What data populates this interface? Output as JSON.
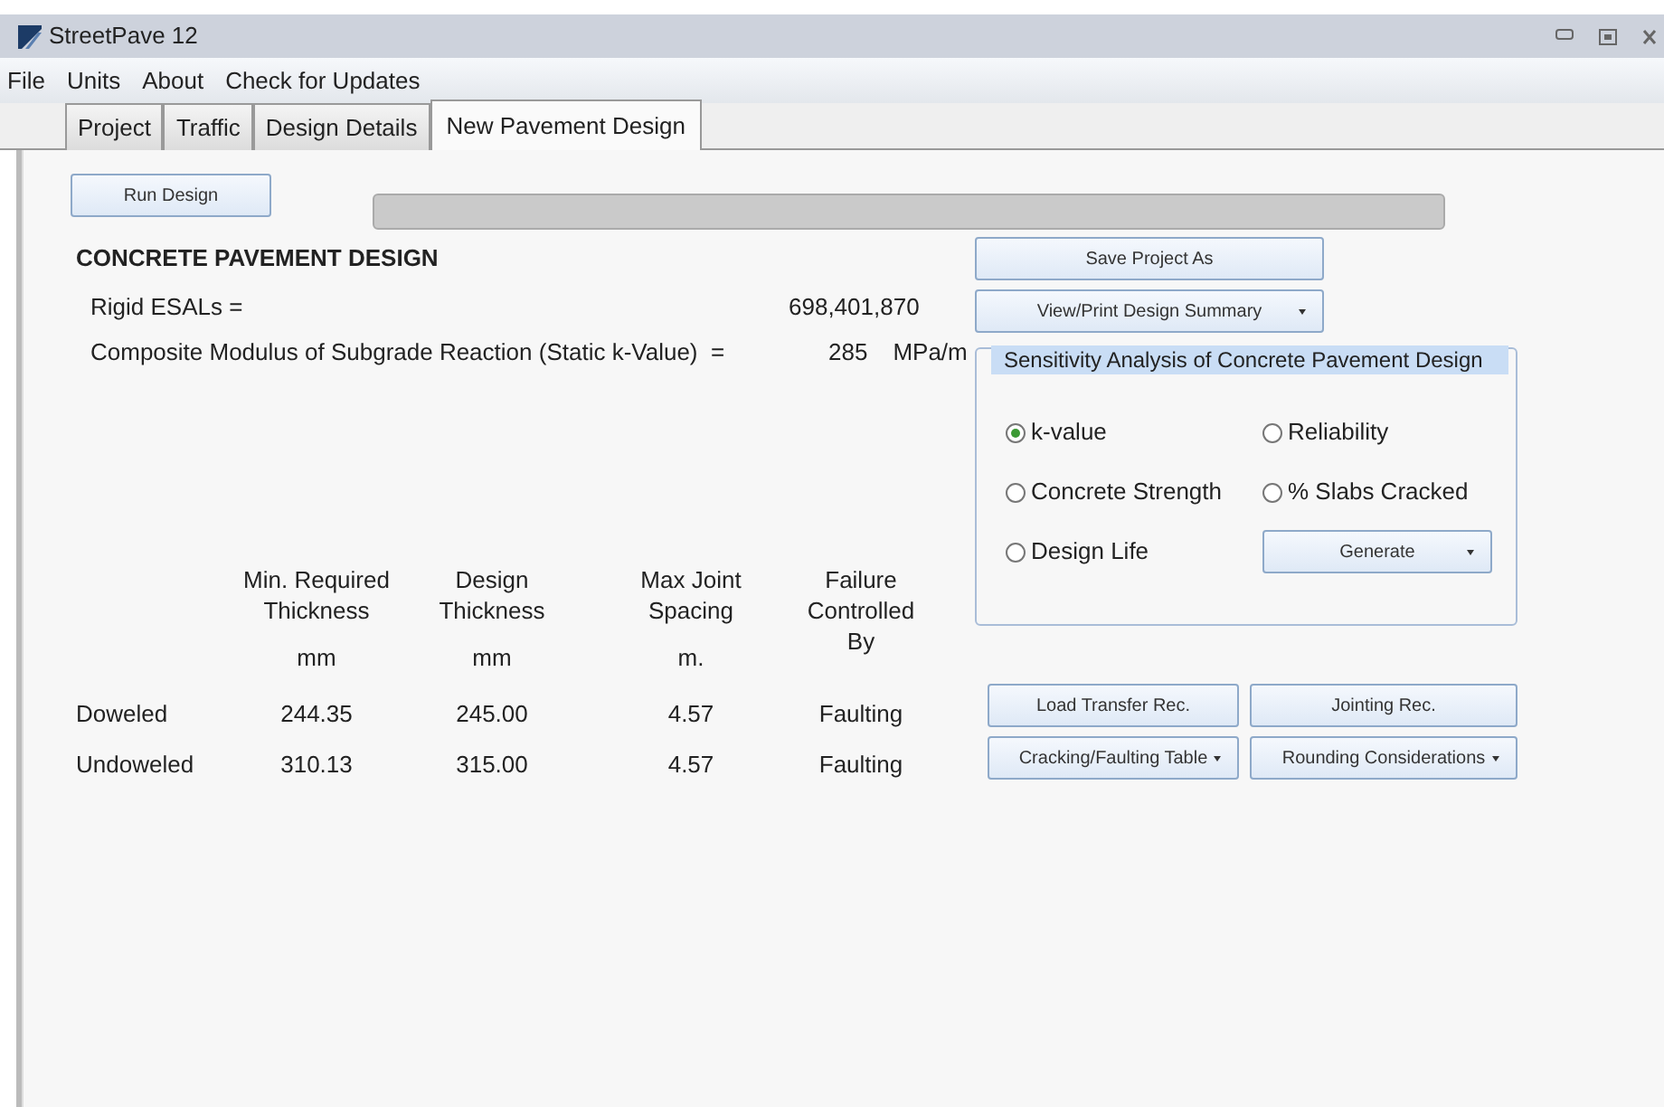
{
  "window": {
    "title": "StreetPave 12"
  },
  "menu": [
    "File",
    "Units",
    "About",
    "Check for Updates"
  ],
  "tabs": [
    {
      "label": "Project",
      "selected": false
    },
    {
      "label": "Traffic",
      "selected": false
    },
    {
      "label": "Design Details",
      "selected": false
    },
    {
      "label": "New Pavement Design",
      "selected": true
    }
  ],
  "run_button": "Run Design",
  "heading": "CONCRETE PAVEMENT DESIGN",
  "results": [
    {
      "label": "Rigid ESALs =",
      "value": "698,401,870"
    },
    {
      "label": "Composite Modulus of Subgrade Reaction (Static k-Value)  =",
      "value": "285",
      "unit": "MPa/m"
    }
  ],
  "table": {
    "columns": [
      {
        "heading": "Min. Required Thickness",
        "unit": "mm"
      },
      {
        "heading": "Design Thickness",
        "unit": "mm"
      },
      {
        "heading": "Max Joint Spacing",
        "unit": "m."
      },
      {
        "heading": "Failure Controlled By"
      }
    ],
    "rows": [
      {
        "label": "Doweled",
        "cells": [
          "244.35",
          "245.00",
          "4.57",
          "Faulting"
        ]
      },
      {
        "label": "Undoweled",
        "cells": [
          "310.13",
          "315.00",
          "4.57",
          "Faulting"
        ]
      }
    ]
  },
  "actions": [
    {
      "label": "Save Project As",
      "kind": "button"
    },
    {
      "label": "View/Print Design Summary",
      "kind": "dropdown"
    }
  ],
  "sensitivity": {
    "title": "Sensitivity Analysis of Concrete Pavement Design",
    "options": [
      {
        "label": "k-value",
        "selected": true
      },
      {
        "label": "Reliability",
        "selected": false
      },
      {
        "label": "Concrete Strength",
        "selected": false
      },
      {
        "label": "% Slabs Cracked",
        "selected": false
      },
      {
        "label": "Design Life",
        "selected": false
      }
    ],
    "generate": {
      "label": "Generate",
      "kind": "dropdown"
    }
  },
  "result_buttons": [
    {
      "label": "Load Transfer Rec.",
      "kind": "button"
    },
    {
      "label": "Jointing Rec.",
      "kind": "button"
    },
    {
      "label": "Cracking/Faulting Table",
      "kind": "dropdown"
    },
    {
      "label": "Rounding Considerations",
      "kind": "dropdown"
    }
  ]
}
